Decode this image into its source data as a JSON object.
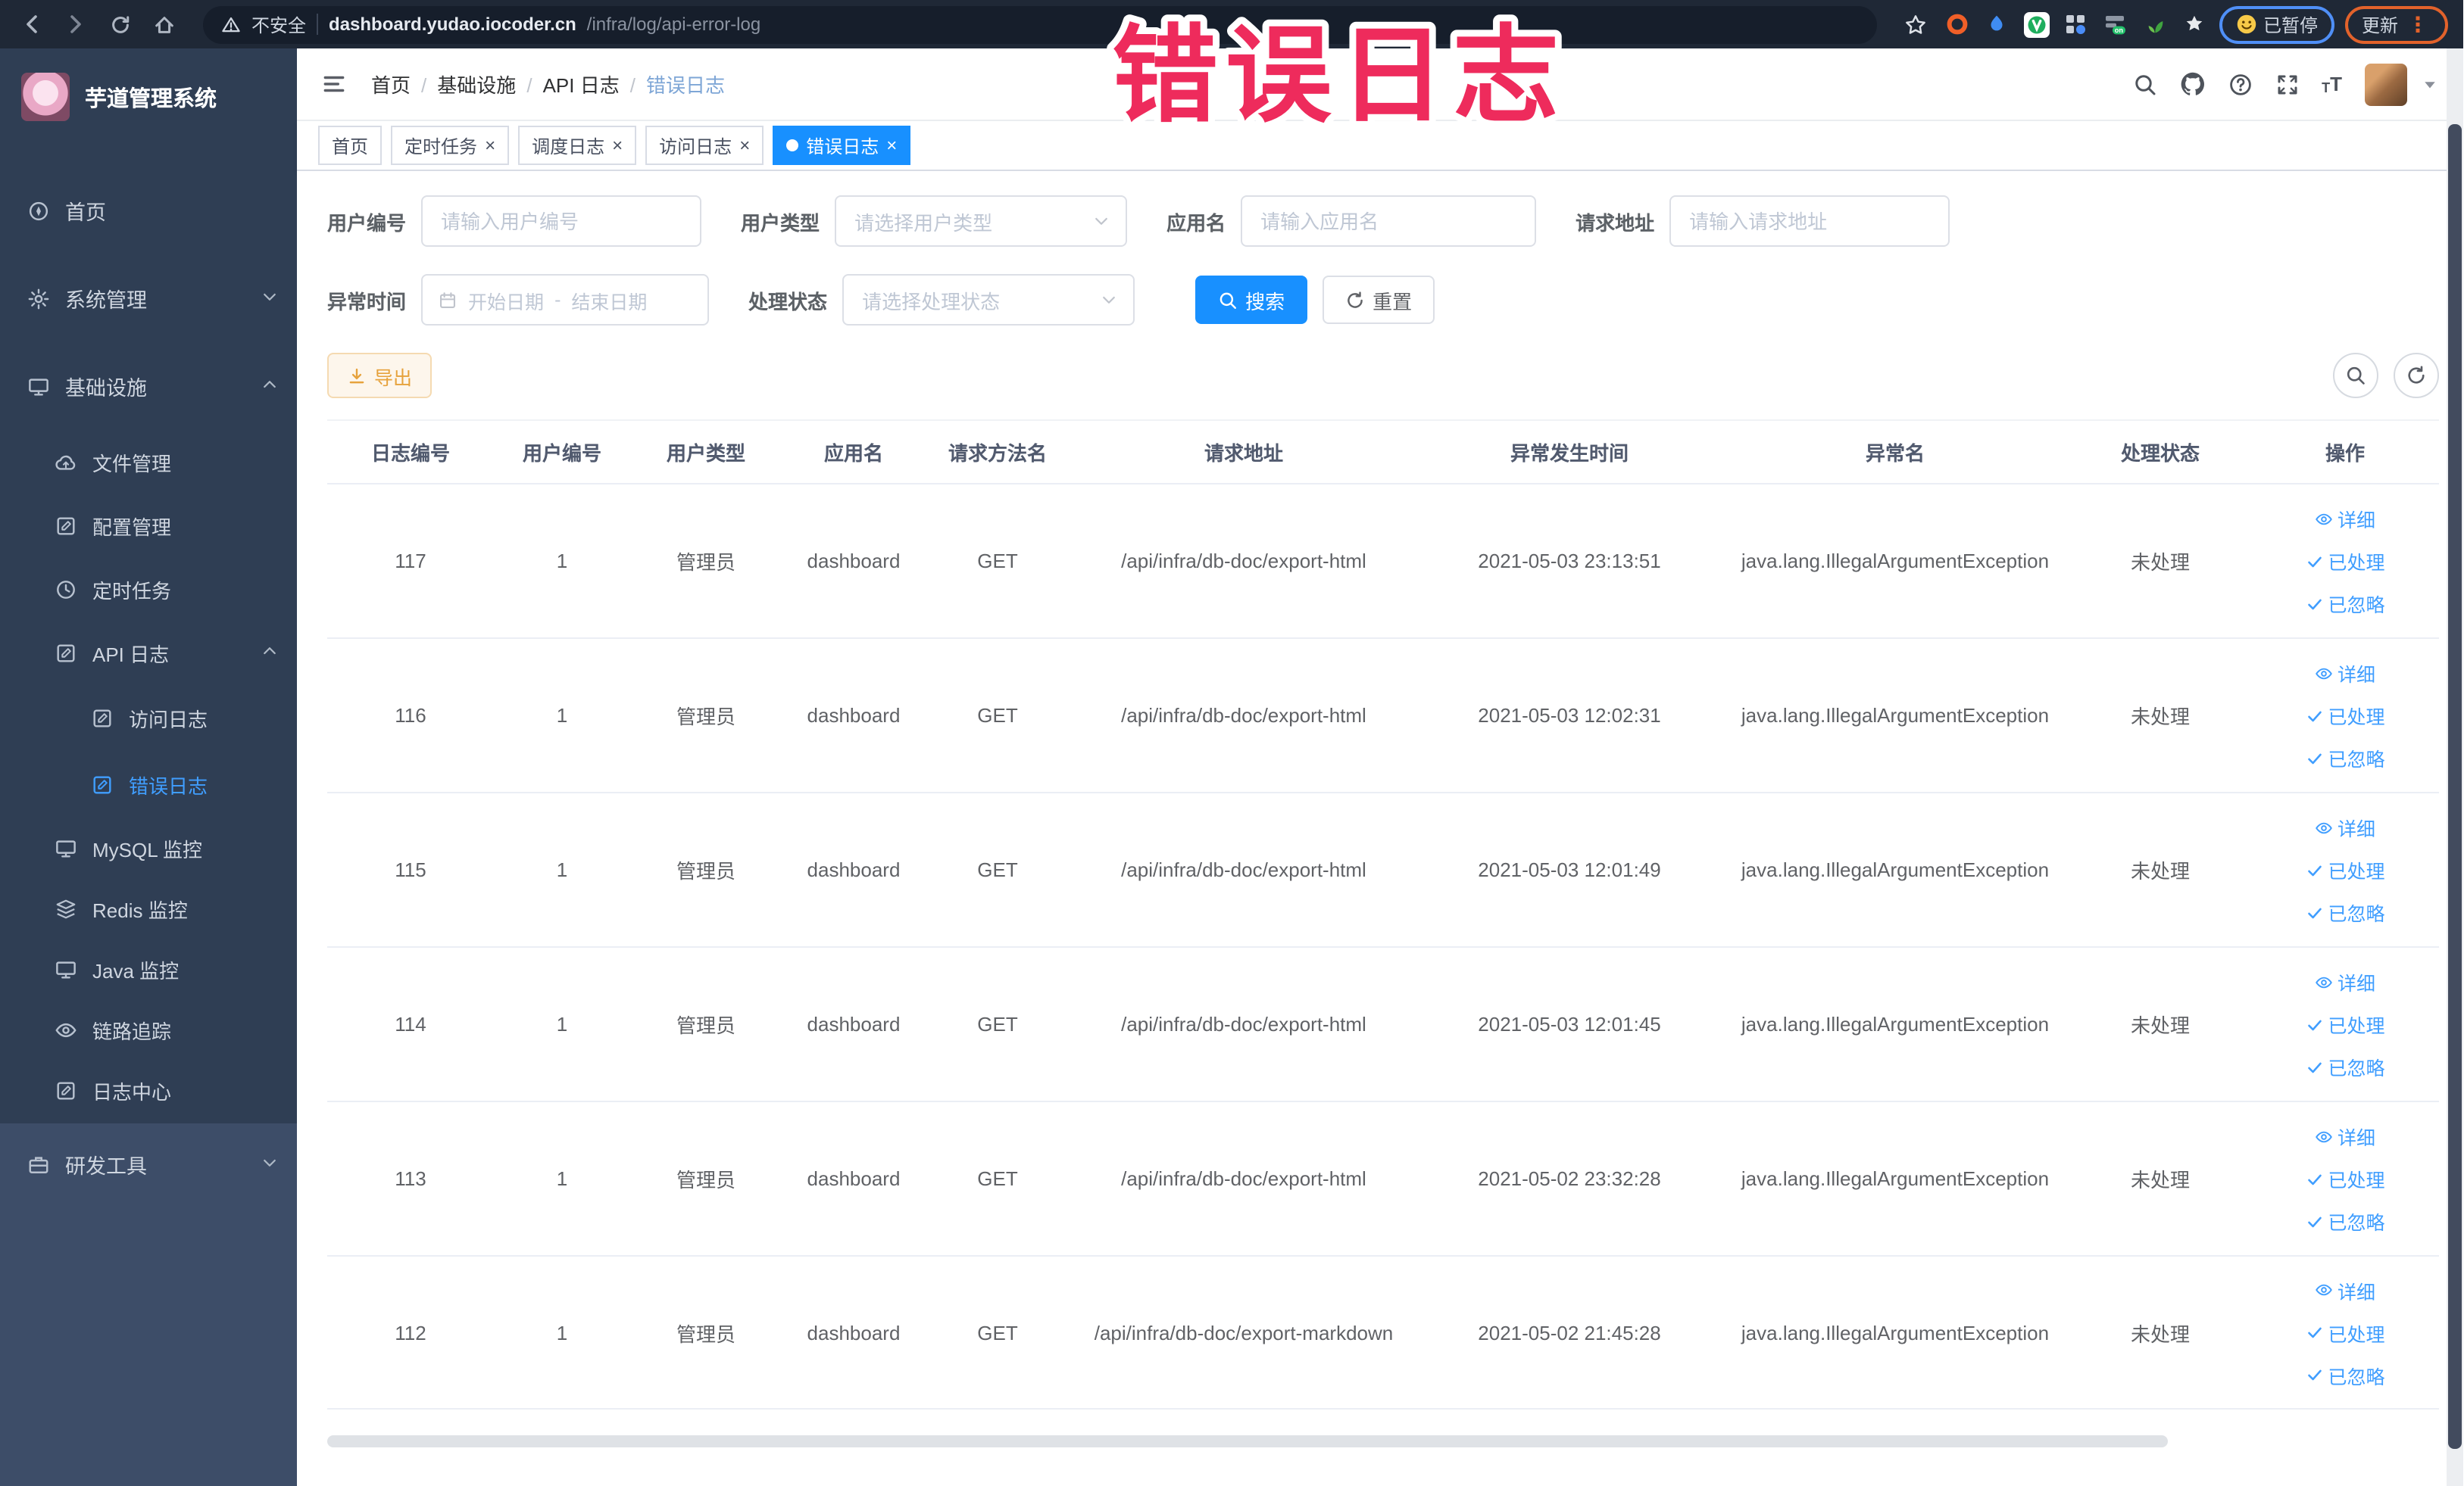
{
  "browser": {
    "security": "不安全",
    "url_host": "dashboard.yudao.iocoder.cn",
    "url_path": "/infra/log/api-error-log",
    "paused": "已暂停",
    "update": "更新"
  },
  "watermark": "错误日志",
  "sidebar": {
    "title": "芋道管理系统",
    "items": [
      {
        "label": "首页"
      },
      {
        "label": "系统管理"
      },
      {
        "label": "基础设施"
      },
      {
        "label": "文件管理"
      },
      {
        "label": "配置管理"
      },
      {
        "label": "定时任务"
      },
      {
        "label": "API 日志"
      },
      {
        "label": "访问日志"
      },
      {
        "label": "错误日志"
      },
      {
        "label": "MySQL 监控"
      },
      {
        "label": "Redis 监控"
      },
      {
        "label": "Java 监控"
      },
      {
        "label": "链路追踪"
      },
      {
        "label": "日志中心"
      },
      {
        "label": "研发工具"
      }
    ]
  },
  "breadcrumb": [
    "首页",
    "基础设施",
    "API 日志",
    "错误日志"
  ],
  "tabs": [
    {
      "label": "首页"
    },
    {
      "label": "定时任务"
    },
    {
      "label": "调度日志"
    },
    {
      "label": "访问日志"
    },
    {
      "label": "错误日志"
    }
  ],
  "filters": {
    "user_id": {
      "label": "用户编号",
      "placeholder": "请输入用户编号"
    },
    "user_type": {
      "label": "用户类型",
      "placeholder": "请选择用户类型"
    },
    "app_name": {
      "label": "应用名",
      "placeholder": "请输入应用名"
    },
    "request_url": {
      "label": "请求地址",
      "placeholder": "请输入请求地址"
    },
    "exception_time": {
      "label": "异常时间",
      "start_placeholder": "开始日期",
      "separator": "-",
      "end_placeholder": "结束日期"
    },
    "process_status": {
      "label": "处理状态",
      "placeholder": "请选择处理状态"
    },
    "search": "搜索",
    "reset": "重置"
  },
  "toolbar": {
    "export": "导出"
  },
  "table": {
    "columns": [
      "日志编号",
      "用户编号",
      "用户类型",
      "应用名",
      "请求方法名",
      "请求地址",
      "异常发生时间",
      "异常名",
      "处理状态",
      "操作"
    ],
    "actions": {
      "detail": "详细",
      "processed": "已处理",
      "ignored": "已忽略"
    },
    "rows": [
      {
        "id": "117",
        "user_id": "1",
        "user_type": "管理员",
        "app": "dashboard",
        "method": "GET",
        "url": "/api/infra/db-doc/export-html",
        "time": "2021-05-03 23:13:51",
        "exception": "java.lang.IllegalArgumentException",
        "status": "未处理"
      },
      {
        "id": "116",
        "user_id": "1",
        "user_type": "管理员",
        "app": "dashboard",
        "method": "GET",
        "url": "/api/infra/db-doc/export-html",
        "time": "2021-05-03 12:02:31",
        "exception": "java.lang.IllegalArgumentException",
        "status": "未处理"
      },
      {
        "id": "115",
        "user_id": "1",
        "user_type": "管理员",
        "app": "dashboard",
        "method": "GET",
        "url": "/api/infra/db-doc/export-html",
        "time": "2021-05-03 12:01:49",
        "exception": "java.lang.IllegalArgumentException",
        "status": "未处理"
      },
      {
        "id": "114",
        "user_id": "1",
        "user_type": "管理员",
        "app": "dashboard",
        "method": "GET",
        "url": "/api/infra/db-doc/export-html",
        "time": "2021-05-03 12:01:45",
        "exception": "java.lang.IllegalArgumentException",
        "status": "未处理"
      },
      {
        "id": "113",
        "user_id": "1",
        "user_type": "管理员",
        "app": "dashboard",
        "method": "GET",
        "url": "/api/infra/db-doc/export-html",
        "time": "2021-05-02 23:32:28",
        "exception": "java.lang.IllegalArgumentException",
        "status": "未处理"
      },
      {
        "id": "112",
        "user_id": "1",
        "user_type": "管理员",
        "app": "dashboard",
        "method": "GET",
        "url": "/api/infra/db-doc/export-markdown",
        "time": "2021-05-02 21:45:28",
        "exception": "java.lang.IllegalArgumentException",
        "status": "未处理"
      }
    ]
  },
  "colors": {
    "primary": "#1890ff",
    "link": "#409eff",
    "warning": "#e6a23c",
    "watermark": "#ee2b5c",
    "sidebar_bg": "#2f3e54",
    "topbar_bg": "#1f2836"
  }
}
